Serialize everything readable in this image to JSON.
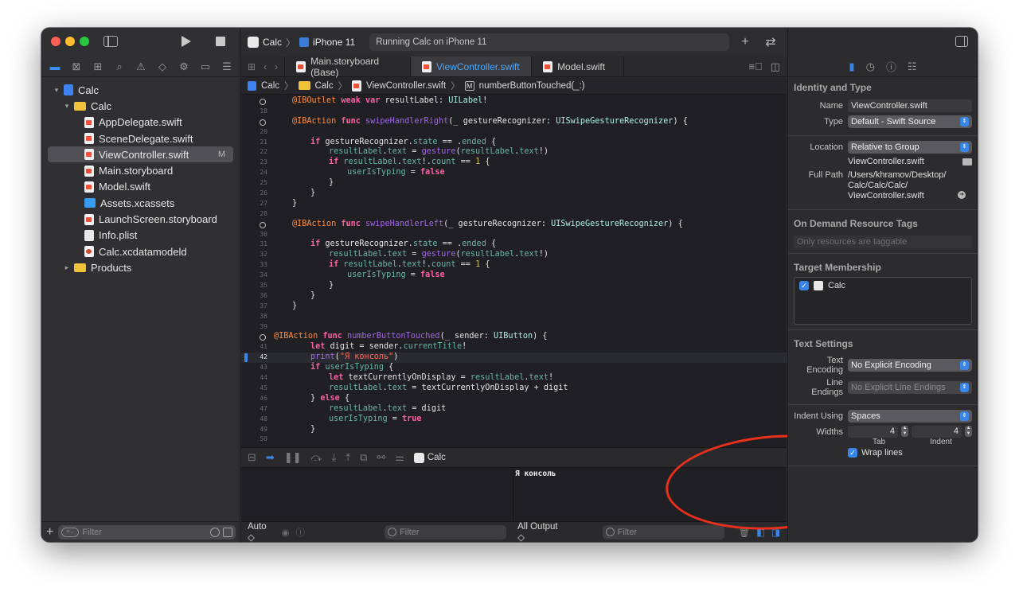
{
  "toolbar": {
    "scheme_name": "Calc",
    "device": "iPhone 11",
    "activity_status": "Running Calc on iPhone 11",
    "add_symbol": "+",
    "swap_symbol": "⇄"
  },
  "navigator": {
    "items": [
      {
        "label": "Calc",
        "icon": "project-icon",
        "indent": 0,
        "disclosure": "▾"
      },
      {
        "label": "Calc",
        "icon": "folder-icon",
        "indent": 1,
        "disclosure": "▾"
      },
      {
        "label": "AppDelegate.swift",
        "icon": "swift-file-icon",
        "indent": 2
      },
      {
        "label": "SceneDelegate.swift",
        "icon": "swift-file-icon",
        "indent": 2
      },
      {
        "label": "ViewController.swift",
        "icon": "swift-file-icon",
        "indent": 2,
        "selected": true,
        "status": "M"
      },
      {
        "label": "Main.storyboard",
        "icon": "storyboard-icon",
        "indent": 2
      },
      {
        "label": "Model.swift",
        "icon": "swift-file-icon",
        "indent": 2
      },
      {
        "label": "Assets.xcassets",
        "icon": "assets-icon",
        "indent": 2
      },
      {
        "label": "LaunchScreen.storyboard",
        "icon": "storyboard-icon",
        "indent": 2
      },
      {
        "label": "Info.plist",
        "icon": "plist-icon",
        "indent": 2
      },
      {
        "label": "Calc.xcdatamodeld",
        "icon": "datamodel-icon",
        "indent": 2
      },
      {
        "label": "Products",
        "icon": "folder-icon",
        "indent": 1,
        "disclosure": "▸"
      }
    ],
    "filter_placeholder": "Filter"
  },
  "tabs": [
    {
      "label": "Main.storyboard (Base)",
      "active": false
    },
    {
      "label": "ViewController.swift",
      "active": true
    },
    {
      "label": "Model.swift",
      "active": false
    }
  ],
  "jumpbar": {
    "project": "Calc",
    "group": "Calc",
    "file": "ViewController.swift",
    "symbol_badge": "M",
    "symbol": "numberButtonTouched(_:)"
  },
  "code_lines": [
    {
      "n": "",
      "circle": true,
      "indent": 0,
      "tokens": [
        [
          "attr",
          "@IBOutlet "
        ],
        [
          "kw",
          "weak var "
        ],
        [
          "plain",
          "resultLabel: "
        ],
        [
          "ty",
          "UILabel"
        ],
        [
          "plain",
          "!"
        ]
      ]
    },
    {
      "n": "18",
      "indent": 0,
      "tokens": []
    },
    {
      "n": "",
      "circle": true,
      "indent": 0,
      "tokens": [
        [
          "attr",
          "@IBAction "
        ],
        [
          "kw",
          "func "
        ],
        [
          "fn",
          "swipeHandlerRight"
        ],
        [
          "plain",
          "(_ gestureRecognizer: "
        ],
        [
          "ty",
          "UISwipeGestureRecognizer"
        ],
        [
          "plain",
          ") {"
        ]
      ]
    },
    {
      "n": "20",
      "indent": 0,
      "tokens": []
    },
    {
      "n": "21",
      "indent": 1,
      "tokens": [
        [
          "kw",
          "if "
        ],
        [
          "plain",
          "gestureRecognizer."
        ],
        [
          "prop",
          "state"
        ],
        [
          "plain",
          " == ."
        ],
        [
          "prop",
          "ended"
        ],
        [
          "plain",
          " {"
        ]
      ]
    },
    {
      "n": "22",
      "indent": 2,
      "tokens": [
        [
          "prop",
          "resultLabel"
        ],
        [
          "plain",
          "."
        ],
        [
          "prop",
          "text"
        ],
        [
          "plain",
          " = "
        ],
        [
          "fn",
          "gesture"
        ],
        [
          "plain",
          "("
        ],
        [
          "prop",
          "resultLabel"
        ],
        [
          "plain",
          "."
        ],
        [
          "prop",
          "text"
        ],
        [
          "plain",
          "!)"
        ]
      ]
    },
    {
      "n": "23",
      "indent": 2,
      "tokens": [
        [
          "kw",
          "if "
        ],
        [
          "prop",
          "resultLabel"
        ],
        [
          "plain",
          "."
        ],
        [
          "prop",
          "text"
        ],
        [
          "plain",
          "!."
        ],
        [
          "prop",
          "count"
        ],
        [
          "plain",
          " == "
        ],
        [
          "num",
          "1"
        ],
        [
          "plain",
          " {"
        ]
      ]
    },
    {
      "n": "24",
      "indent": 3,
      "tokens": [
        [
          "prop",
          "userIsTyping"
        ],
        [
          "plain",
          " = "
        ],
        [
          "kw",
          "false"
        ]
      ]
    },
    {
      "n": "25",
      "indent": 2,
      "tokens": [
        [
          "plain",
          "}"
        ]
      ]
    },
    {
      "n": "26",
      "indent": 1,
      "tokens": [
        [
          "plain",
          "}"
        ]
      ]
    },
    {
      "n": "27",
      "indent": 0,
      "tokens": [
        [
          "plain",
          "}"
        ]
      ]
    },
    {
      "n": "28",
      "indent": 0,
      "tokens": []
    },
    {
      "n": "",
      "circle": true,
      "indent": 0,
      "tokens": [
        [
          "attr",
          "@IBAction "
        ],
        [
          "kw",
          "func "
        ],
        [
          "fn",
          "swipeHandlerLeft"
        ],
        [
          "plain",
          "(_ gestureRecognizer: "
        ],
        [
          "ty",
          "UISwipeGestureRecognizer"
        ],
        [
          "plain",
          ") {"
        ]
      ]
    },
    {
      "n": "30",
      "indent": 0,
      "tokens": []
    },
    {
      "n": "31",
      "indent": 1,
      "tokens": [
        [
          "kw",
          "if "
        ],
        [
          "plain",
          "gestureRecognizer."
        ],
        [
          "prop",
          "state"
        ],
        [
          "plain",
          " == ."
        ],
        [
          "prop",
          "ended"
        ],
        [
          "plain",
          " {"
        ]
      ]
    },
    {
      "n": "32",
      "indent": 2,
      "tokens": [
        [
          "prop",
          "resultLabel"
        ],
        [
          "plain",
          "."
        ],
        [
          "prop",
          "text"
        ],
        [
          "plain",
          " = "
        ],
        [
          "fn",
          "gesture"
        ],
        [
          "plain",
          "("
        ],
        [
          "prop",
          "resultLabel"
        ],
        [
          "plain",
          "."
        ],
        [
          "prop",
          "text"
        ],
        [
          "plain",
          "!)"
        ]
      ]
    },
    {
      "n": "33",
      "indent": 2,
      "tokens": [
        [
          "kw",
          "if "
        ],
        [
          "prop",
          "resultLabel"
        ],
        [
          "plain",
          "."
        ],
        [
          "prop",
          "text"
        ],
        [
          "plain",
          "!."
        ],
        [
          "prop",
          "count"
        ],
        [
          "plain",
          " == "
        ],
        [
          "num",
          "1"
        ],
        [
          "plain",
          " {"
        ]
      ]
    },
    {
      "n": "34",
      "indent": 3,
      "tokens": [
        [
          "prop",
          "userIsTyping"
        ],
        [
          "plain",
          " = "
        ],
        [
          "kw",
          "false"
        ]
      ]
    },
    {
      "n": "35",
      "indent": 2,
      "tokens": [
        [
          "plain",
          "}"
        ]
      ]
    },
    {
      "n": "36",
      "indent": 1,
      "tokens": [
        [
          "plain",
          "}"
        ]
      ]
    },
    {
      "n": "37",
      "indent": 0,
      "tokens": [
        [
          "plain",
          "}"
        ]
      ]
    },
    {
      "n": "38",
      "indent": 0,
      "tokens": []
    },
    {
      "n": "39",
      "indent": 0,
      "tokens": []
    },
    {
      "n": "",
      "circle": true,
      "indent": -1,
      "tokens": [
        [
          "attr",
          "@IBAction "
        ],
        [
          "kw",
          "func "
        ],
        [
          "fn",
          "numberButtonTouched"
        ],
        [
          "plain",
          "(_ sender: "
        ],
        [
          "ty",
          "UIButton"
        ],
        [
          "plain",
          ") {"
        ]
      ]
    },
    {
      "n": "41",
      "indent": 1,
      "tokens": [
        [
          "kw",
          "let "
        ],
        [
          "plain",
          "digit = sender."
        ],
        [
          "prop",
          "currentTitle"
        ],
        [
          "plain",
          "!"
        ]
      ]
    },
    {
      "n": "42",
      "indent": 1,
      "current": true,
      "marker": true,
      "tokens": [
        [
          "fn",
          "print"
        ],
        [
          "plain",
          "("
        ],
        [
          "str",
          "\"Я консоль\""
        ],
        [
          "plain",
          ")"
        ]
      ]
    },
    {
      "n": "43",
      "indent": 1,
      "tokens": [
        [
          "kw",
          "if "
        ],
        [
          "prop",
          "userIsTyping"
        ],
        [
          "plain",
          " {"
        ]
      ]
    },
    {
      "n": "44",
      "indent": 2,
      "tokens": [
        [
          "kw",
          "let "
        ],
        [
          "plain",
          "textCurrentlyOnDisplay = "
        ],
        [
          "prop",
          "resultLabel"
        ],
        [
          "plain",
          "."
        ],
        [
          "prop",
          "text"
        ],
        [
          "plain",
          "!"
        ]
      ]
    },
    {
      "n": "45",
      "indent": 2,
      "tokens": [
        [
          "prop",
          "resultLabel"
        ],
        [
          "plain",
          "."
        ],
        [
          "prop",
          "text"
        ],
        [
          "plain",
          " = textCurrentlyOnDisplay + digit"
        ]
      ]
    },
    {
      "n": "46",
      "indent": 1,
      "tokens": [
        [
          "plain",
          "} "
        ],
        [
          "kw",
          "else"
        ],
        [
          "plain",
          " {"
        ]
      ]
    },
    {
      "n": "47",
      "indent": 2,
      "tokens": [
        [
          "prop",
          "resultLabel"
        ],
        [
          "plain",
          "."
        ],
        [
          "prop",
          "text"
        ],
        [
          "plain",
          " = digit"
        ]
      ]
    },
    {
      "n": "48",
      "indent": 2,
      "tokens": [
        [
          "prop",
          "userIsTyping"
        ],
        [
          "plain",
          " = "
        ],
        [
          "kw",
          "true"
        ]
      ]
    },
    {
      "n": "49",
      "indent": 1,
      "tokens": [
        [
          "plain",
          "}"
        ]
      ]
    },
    {
      "n": "50",
      "indent": 0,
      "tokens": []
    }
  ],
  "debug": {
    "target_label": "Calc",
    "console_output": "Я консоль",
    "vars_scope": "Auto ◇",
    "output_scope": "All Output ◇",
    "filter_placeholder": "Filter"
  },
  "inspector": {
    "identity_heading": "Identity and Type",
    "name_label": "Name",
    "name_value": "ViewController.swift",
    "type_label": "Type",
    "type_value": "Default - Swift Source",
    "location_label": "Location",
    "location_value": "Relative to Group",
    "location_file": "ViewController.swift",
    "fullpath_label": "Full Path",
    "fullpath_line1": "/Users/khramov/Desktop/",
    "fullpath_line2": "Calc/Calc/Calc/",
    "fullpath_line3": "ViewController.swift",
    "tags_heading": "On Demand Resource Tags",
    "tags_placeholder": "Only resources are taggable",
    "membership_heading": "Target Membership",
    "membership_target": "Calc",
    "text_settings_heading": "Text Settings",
    "encoding_label": "Text Encoding",
    "encoding_value": "No Explicit Encoding",
    "line_endings_label": "Line Endings",
    "line_endings_value": "No Explicit Line Endings",
    "indent_using_label": "Indent Using",
    "indent_using_value": "Spaces",
    "widths_label": "Widths",
    "tab_width": "4",
    "indent_width": "4",
    "tab_sublabel": "Tab",
    "indent_sublabel": "Indent",
    "wrap_label": "Wrap lines"
  },
  "colors": {
    "accent": "#3a86e8",
    "annotation_ellipse": "#e8301c",
    "keyword": "#fc5fa3",
    "string": "#fc6a5d",
    "type": "#acf2e4"
  }
}
